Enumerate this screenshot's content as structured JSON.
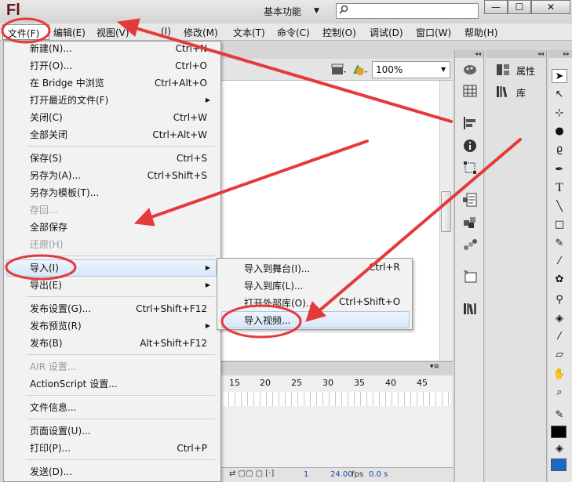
{
  "app": {
    "logo": "Fl",
    "workspace": "基本功能",
    "search_placeholder": ""
  },
  "window": {
    "minimize": "—",
    "maximize": "☐",
    "close": "✕"
  },
  "menubar": [
    "文件(F)",
    "编辑(E)",
    "视图(V)",
    "(I)",
    "修改(M)",
    "文本(T)",
    "命令(C)",
    "控制(O)",
    "调试(D)",
    "窗口(W)",
    "帮助(H)"
  ],
  "file_menu": [
    {
      "label": "新建(N)...",
      "shortcut": "Ctrl+N"
    },
    {
      "label": "打开(O)...",
      "shortcut": "Ctrl+O"
    },
    {
      "label": "在 Bridge 中浏览",
      "shortcut": "Ctrl+Alt+O"
    },
    {
      "label": "打开最近的文件(F)",
      "shortcut": ""
    },
    {
      "label": "关闭(C)",
      "shortcut": "Ctrl+W"
    },
    {
      "label": "全部关闭",
      "shortcut": "Ctrl+Alt+W"
    },
    {
      "label": "保存(S)",
      "shortcut": "Ctrl+S"
    },
    {
      "label": "另存为(A)...",
      "shortcut": "Ctrl+Shift+S"
    },
    {
      "label": "另存为模板(T)...",
      "shortcut": ""
    },
    {
      "label": "存回...",
      "shortcut": ""
    },
    {
      "label": "全部保存",
      "shortcut": ""
    },
    {
      "label": "还原(H)",
      "shortcut": ""
    },
    {
      "label": "导入(I)",
      "shortcut": ""
    },
    {
      "label": "导出(E)",
      "shortcut": ""
    },
    {
      "label": "发布设置(G)...",
      "shortcut": "Ctrl+Shift+F12"
    },
    {
      "label": "发布预览(R)",
      "shortcut": ""
    },
    {
      "label": "发布(B)",
      "shortcut": "Alt+Shift+F12"
    },
    {
      "label": "AIR 设置...",
      "shortcut": ""
    },
    {
      "label": "ActionScript 设置...",
      "shortcut": ""
    },
    {
      "label": "文件信息...",
      "shortcut": ""
    },
    {
      "label": "页面设置(U)...",
      "shortcut": ""
    },
    {
      "label": "打印(P)...",
      "shortcut": "Ctrl+P"
    },
    {
      "label": "发送(D)...",
      "shortcut": ""
    }
  ],
  "import_submenu": [
    {
      "label": "导入到舞台(I)...",
      "shortcut": "Ctrl+R"
    },
    {
      "label": "导入到库(L)...",
      "shortcut": ""
    },
    {
      "label": "打开外部库(O)...",
      "shortcut": "Ctrl+Shift+O"
    },
    {
      "label": "导入视频...",
      "shortcut": ""
    }
  ],
  "stage": {
    "zoom": "100%"
  },
  "timeline": {
    "frame_numbers": [
      "15",
      "20",
      "25",
      "30",
      "35",
      "40",
      "45"
    ],
    "footer_frame": "1",
    "fps": "24.00",
    "fps_unit": "fps",
    "time": "0.0 s"
  },
  "panels": {
    "properties": "属性",
    "library": "库"
  },
  "colors": {
    "highlight": "#d7e7f8",
    "annotation": "#e53a3a",
    "logo": "#6b1414"
  }
}
